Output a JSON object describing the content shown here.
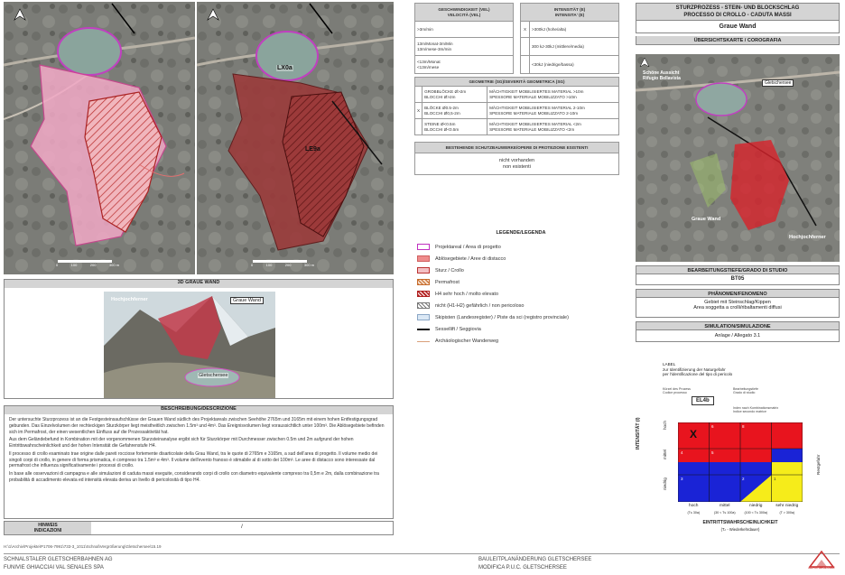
{
  "maps": {
    "left_map": {
      "scale_labels": [
        "0",
        "100",
        "200",
        "300 m"
      ]
    },
    "right_map": {
      "label_lake": "LX0a",
      "label_zone": "LE9a",
      "scale_labels": [
        "0",
        "100",
        "200",
        "300 m"
      ]
    },
    "view3d": {
      "title": "3D GRAUE WAND",
      "labels": {
        "peak": "Hochjochferner",
        "wall": "Graue Wand",
        "lake": "Gletschersee"
      }
    }
  },
  "velocity": {
    "header": "GESCHWINDIGKEIT (VEL)\nVELOCITÀ (VEL)",
    "rows": [
      ">3m/min",
      "13m/Monat-3m/Min\n13m/mese-3m/min",
      "<13m/Monat\n<13m/mese"
    ]
  },
  "intensity": {
    "header": "INTENSITÄT (E)\nINTENSITA' (E)",
    "rows": [
      {
        "mark": "X",
        "text": ">300kJ (hohe/alta)"
      },
      {
        "mark": "",
        "text": "300 kJ-30kJ (mittlere/media)"
      },
      {
        "mark": "",
        "text": "<30kJ (niedrige/bassa)"
      }
    ]
  },
  "geometry": {
    "header": "GEOMETRIE (SG)/SEVERITÀ GEOMETRICA (SG)",
    "rows": [
      {
        "mark": "",
        "a": "GROBBLÖCKE Ø>2m\nBLOCCHI Ø>2m",
        "b": "MÄCHTIGKEIT MOBILISIERTES MATERIAL >10m\nSPESSORE MATERIALE MOBILIZZATO >10m"
      },
      {
        "mark": "X",
        "a": "BLÖCKE Ø0.5-2m\nBLOCCHI Ø0,5-2m",
        "b": "MÄCHTIGKEIT MOBILISIERTES MATERIAL 2-10m\nSPESSORE MATERIALE MOBILIZZATO 2-10m"
      },
      {
        "mark": "",
        "a": "STEINE Ø<0.5m\nBLOCCHI Ø<0.5m",
        "b": "MÄCHTIGKEIT MOBILISIERTES MATERIAL <2m\nSPESSORE MATERIALE MOBILIZZATO <2m"
      }
    ]
  },
  "protection": {
    "header": "BESTEHENDE SCHUTZBAUWERKE/OPERE DI PROTEZIONE ESISTENTI",
    "value": "nicht vorhanden\nnon esistenti"
  },
  "legend": {
    "title": "LEGENDE/LEGENDA",
    "items": [
      {
        "swatch": "project",
        "label": "Projektareal / Area di progetto"
      },
      {
        "swatch": "release",
        "label": "Ablösegebiete / Aree di distacco"
      },
      {
        "swatch": "runout",
        "label": "Sturz / Crollo"
      },
      {
        "swatch": "permafrost",
        "label": "Permafrost"
      },
      {
        "swatch": "h4",
        "label": "H4 sehr hoch / molto elevato"
      },
      {
        "swatch": "h1h2",
        "label": "nicht (H1-H2) gefährlich / non pericoloso"
      },
      {
        "swatch": "ski",
        "label": "Skipisten (Landesregister) / Piste da sci (registro provinciale)"
      },
      {
        "swatch": "lift",
        "label": "Sessellift / Seggiovia"
      },
      {
        "swatch": "trail",
        "label": "Archäologischer Wanderweg"
      }
    ]
  },
  "right_panel": {
    "process_title": "STURZPROZESS - STEIN- UND BLOCKSCHLAG\nPROCESSO DI CROLLO - CADUTA MASSI",
    "site": "Graue Wand",
    "overview_header": "ÜBERSICHTSKARTE / COROGRAFIA",
    "overview_labels": {
      "hut": "Schöne Aussicht\nRifugio Bellavista",
      "lake": "Gletschersee",
      "wall": "Graue Wand",
      "glacier": "Hochjochferner"
    },
    "depth_header": "BEARBEITUNGSTIEFE/GRADO DI STUDIO",
    "depth_value": "BT05",
    "phenomenon_header": "PHÄNOMEN/FENOMENO",
    "phenomenon_value": "Gebiet mit Steinschlag/Kippen\nArea soggetta a crolli/ribaltamenti diffusi",
    "simulation_header": "SIMULATION/SIMULAZIONE",
    "simulation_value": "Anlage / Allegato 3.1"
  },
  "matrix": {
    "label_title": "LABEL\nzur Identifizierung der Naturgefahr\nper l'identificazione del tipo di pericolo",
    "label_code": "EL4b",
    "annot_left": "Kürzel des Prozess\nCodice processo",
    "annot_right_top": "Bearbeitungstiefe\nGrado di studio",
    "annot_right_bottom": "Index nach Kombinationsmatrix\nIndice secondo matrice",
    "y_axis": "INTENSITÄT (I)",
    "y_ticks": [
      "hoch",
      "mittel",
      "niedrig"
    ],
    "x_ticks": [
      "hoch",
      "mittel",
      "niedrig",
      "sehr niedrig"
    ],
    "x_subticks": [
      "(T≤ 30a)",
      "(30 < T≤ 100a)",
      "(100 < T≤ 300a)",
      "(T > 300a)"
    ],
    "x_axis": "EINTRITTSWAHRSCHEINLICHKEIT",
    "x_axis_sub": "(Tₙ - Wiederkehrdauer)",
    "right_label": "Restgefahr",
    "mark": "X",
    "numbers": [
      "4",
      "6",
      "8",
      "3",
      "5",
      "2",
      "1"
    ],
    "colors": {
      "red": "#e8141e",
      "blue": "#1a23d6",
      "yellow": "#f6ec1a"
    }
  },
  "description": {
    "header": "BESCHREIBUNG/DESCRIZIONE",
    "p1": "Der untersuchte Sturzprozess ist an die Festgesteinsaufschlüsse der Grauen Wand südlich des Projektareals zwischen Seehöhe 2765m und 3165m mit einem hohen Entfestigungsgrad gebunden. Das Einzelvolumen der rechteckigen Sturzkörper liegt meistheitlich zwischen 1.5m³ und 4m³. Das Ereignisvolumen liegt voraussichtlich unter 100m³. Die Ablösegebiete befinden sich im Permafrost, der einen wesentlichen Einfluss auf die Prozessaktivität hat.",
    "p2": "Aus dem Geländebefund in Kombination mit der vorgenommenen Sturzsteinanalyse ergibt sich für Sturzkörper mit Durchmesser zwischen 0.5m und 2m aufgrund der hohen Eintrittswahrscheinlichkeit und der hohen Intensität die Gefahrenstufe H4.",
    "p3": "Il processo di crollo esaminato trae origine dalle pareti rocciose fortemente disarticolate della Grau Wand, tra le quote di 2765m e 3165m, a sud dell'area di progetto. Il volume medio dei singoli corpi di crollo, in genere di forma prismatica, è compreso tra 1.5m³ e 4m³. Il volume dell'evento franoso è stimabile al di sotto dei 100m³. Le aree di distacco sono interessate dal permafrost che influenza significativamente i processi di crollo.",
    "p4": "In base alle osservazioni di campagna e alle simulazioni di caduta massi eseguite, considerando corpi di crollo con diametro equivalente compreso tra 0,5m e 2m, dalla combinazione tra probabilità di accadimento elevata ed intensità elevata deriva un livello di pericolosità di tipo H4."
  },
  "notes": {
    "label": "HINWEIS\nINDICAZIONI",
    "value": "/"
  },
  "footer": {
    "path": "H:\\1\\Archiv\\Projekte\\P1706-7991\\733-3_1011\\Schnal\\Vergrößerung\\Gletschersee\\15.19",
    "company_de": "SCHNALSTALER GLETSCHERBAHNEN AG",
    "company_it": "FUNIVIE GHIACCIAI VAL SENALES SPA",
    "project_de": "BAULEITPLANÄNDERUNG GLETSCHERSEE",
    "project_it": "MODIFICA P.U.C. GLETSCHERSEE",
    "logo_text": "ALPIN GEOLOGIE"
  }
}
